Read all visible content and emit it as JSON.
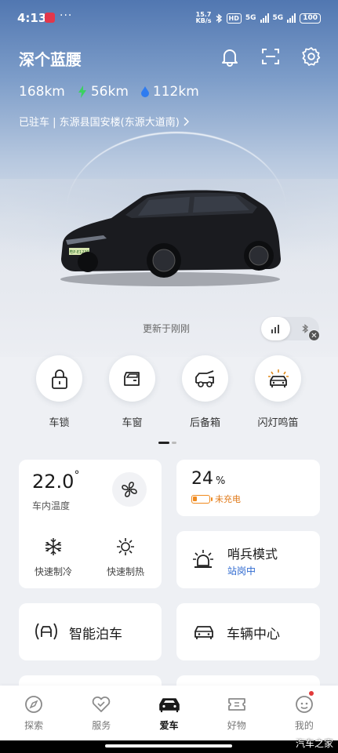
{
  "status_bar": {
    "time": "4:13",
    "dots": "···",
    "net_speed_value": "15.7",
    "net_speed_unit": "KB/s",
    "hd": "HD",
    "network_1": "5G",
    "network_2": "5G",
    "battery": "100"
  },
  "header": {
    "car_name": "深个蓝腰"
  },
  "ranges": {
    "total": "168km",
    "electric": "56km",
    "fuel": "112km"
  },
  "location": "已驻车 | 东源县国安楼(东源大道南)",
  "license_plate": "粤P·E1229",
  "update_status": "更新于刚刚",
  "quick_actions": [
    {
      "label": "车锁",
      "icon": "lock-icon"
    },
    {
      "label": "车窗",
      "icon": "car-window-icon"
    },
    {
      "label": "后备箱",
      "icon": "trunk-icon"
    },
    {
      "label": "闪灯鸣笛",
      "icon": "flash-horn-icon"
    }
  ],
  "climate": {
    "temperature": "22.0",
    "degree": "°",
    "label": "车内温度",
    "cool_label": "快速制冷",
    "heat_label": "快速制热"
  },
  "battery_card": {
    "percent": "24",
    "unit": "%",
    "status": "未充电",
    "level": 0.24
  },
  "sentry": {
    "title": "哨兵模式",
    "status": "站岗中"
  },
  "features": {
    "parking": "智能泊车",
    "vehicle_center": "车辆中心"
  },
  "tabs": [
    {
      "label": "探索",
      "icon": "compass-icon"
    },
    {
      "label": "服务",
      "icon": "service-heart-icon"
    },
    {
      "label": "爱车",
      "icon": "car-icon"
    },
    {
      "label": "好物",
      "icon": "ticket-icon"
    },
    {
      "label": "我的",
      "icon": "profile-icon"
    }
  ],
  "watermark": "汽车之家",
  "colors": {
    "accent_blue": "#2f6ad0",
    "electric_green": "#3ad25f",
    "fuel_blue": "#2f7cf0",
    "warning_orange": "#f08a1e"
  }
}
